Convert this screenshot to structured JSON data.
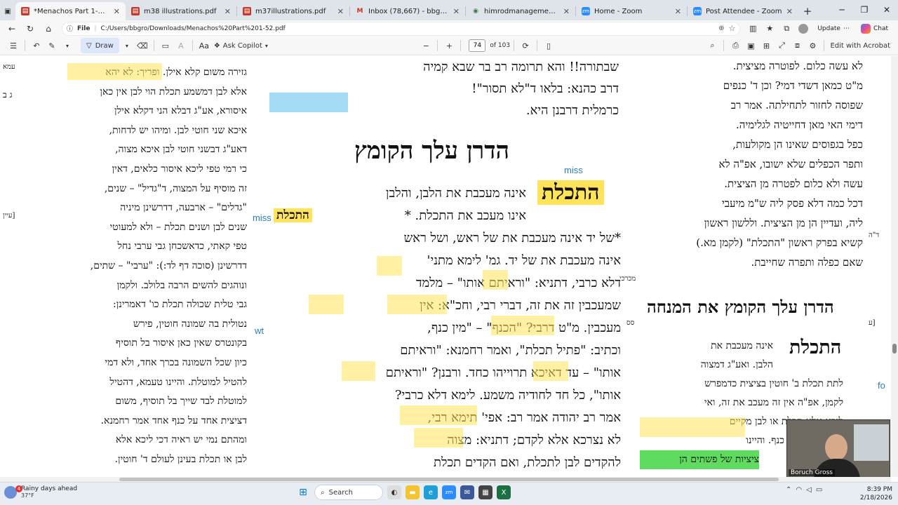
{
  "tabs": [
    {
      "label": "*Menachos Part 1-52.pdf",
      "icon": "pdf-icon",
      "active": true
    },
    {
      "label": "m38 illustrations.pdf",
      "icon": "pdf-icon"
    },
    {
      "label": "m37illustrations.pdf",
      "icon": "pdf-icon"
    },
    {
      "label": "Inbox (78,667) - bbgross10@gm...",
      "icon": "gmail-icon"
    },
    {
      "label": "himrodmanagementllc.manageb...",
      "icon": "web-icon"
    },
    {
      "label": "Home - Zoom",
      "icon": "zoom-icon"
    },
    {
      "label": "Post Attendee - Zoom",
      "icon": "zoom-icon"
    }
  ],
  "address": {
    "label": "File",
    "url": "C:/Users/bbgro/Downloads/Menachos%20Part%201-52.pdf"
  },
  "browser": {
    "update_label": "Update",
    "chat_label": "Chat"
  },
  "pdf_toolbar": {
    "draw_label": "Draw",
    "ask_label": "Ask Copilot",
    "page_current": "74",
    "page_total": "of 103",
    "edit_label": "Edit with Acrobat"
  },
  "document": {
    "left_col": [
      "גזירה משום קלא אילן. ופריך: לא יהא",
      "אלא לבן דמשמע תכלת הוי לבן אין כאן",
      "איסורא, אע\"ג דבלא הני דקלא אילן",
      "איכא שני חוטי לבן. ומיהו יש לדחות,",
      "דאע\"ג דבשני חוטי לבן איכא מצוה,",
      "כי רמי טפי ליכא איסור כלאים, דאין",
      "זה מוסיף על המצוה, ד\"גדיל\" – שנים,",
      "\"גדלים\" – ארבעה, דדרשינן מיניה",
      "שנים לבן ושנים תכלת – ולא למעוטי",
      "טפי קאתי, כדאשכחן גבי ערבי נחל",
      "דדרשינן (סוכה דף לד:): \"ערבי\" – שתים,",
      "ונוהגים להשים הרבה בלולב. ולקמן",
      "גבי טלית שכולה תכלת כו' דאמרינן:",
      "נטולית בה שמונה חוטין, פירש",
      "בקונטרס שאין כאן איסור בל תוסיף",
      "כיון שכל השמונה בכרך אחד, ולא דמי",
      "להטיל למוטלת. והיינו טעמא, דהטיל",
      "למוטלת לבד שייך בל תוסיף, משום",
      "דציצית אחד על כנף אחד אמר רחמנא.",
      "ומהתם נמי יש ראיה דכי ליכא אלא",
      "לבן או תכלת בעינן לעולם ד' חוטין."
    ],
    "center_top": [
      "שבתורה!! והא תרומה רב בר שבא קמיה",
      "דרב כהנא: בלאו ד\"לא תסור\"!",
      "כרמלית דרבנן היא."
    ],
    "center_title": "הדרן עלך הקומץ",
    "center_body": [
      "אינה מעכבת את הלבן, והלבן",
      "אינו מעכב את התכלת. *",
      "*של יד אינה מעכבת את של ראש, ושל ראש",
      "אינה מעכבת את של יד. גמ' לימא מתני'",
      "דלא כרבי, דתניא: \"וראיתם אותו\" – מלמד",
      "שמעכבין זה את זה, דברי רבי, וחכ\"א: אין",
      "מעכבין. מ\"ט דרבי? \"הכנף\" – \"מין כנף,",
      "וכתיב: \"פתיל תכלת\", ואמר רחמנא: \"וראיתם",
      "אותו\" – עד דאיכא תרוייהו כחד. ורבנן? \"וראיתם",
      "אותו\", כל חד לחודיה משמע. לימא דלא כרבי?",
      "אמר רב יהודה אמר רב: אפי' תימא רבי,",
      "לא נצרכא אלא לקדם; דתניא: מצוה",
      "להקדים לבן לתכלת, ואם הקדים תכלת"
    ],
    "center_hl_word": "התכלת",
    "center_hl_small": "התכלת",
    "right_col": [
      "לא עשה כלום. לפוטרה מציצית.",
      "מ\"ט כמאן דשדי דמי? וכן ד' כנפים",
      "שפוסה לחזור לתחילתה. אמר רב",
      "דימי האי מאן דחייטיה לגלימיה.",
      "כפל בגפוסים שאינו הן מקולעות,",
      "ותפר הכפלים שלא ישובו, אפ\"ה לא",
      "עשה ולא כלום לפטרה מן הציצית.",
      "דכל כמה דלא פסק ליה ש\"מ מיעבי",
      "ליה, ועדיין הן מן הציצית. וללשון ראשון",
      "קשיא בפרק ראשון \"התכלת\" (לקמן מא.)",
      "שאם כפלה ותפרה שחייבת."
    ],
    "right_heading": "הדרן עלך הקומץ את המנחה",
    "right_hl_word": "התכלת",
    "right_lower": [
      "אינה מעכבת את",
      "הלבן. ואע\"ג דמצוה",
      "לתת תכלת ב' חוטין בציצית כדמפרש",
      "לקמן, אפ\"ה אין זה מעכב את זה, ואי",
      "ליכא אלא תכלת או לבן מקיים",
      "מצוה, כמו: מין כנף. והיינו",
      "ציציות של פשתים הן"
    ],
    "margins": [
      "עמא",
      "ג ב",
      "[עיין",
      "ד\"ה",
      "מכרכי",
      "סס",
      "[ע"
    ],
    "annotations": [
      "miss",
      "miss",
      "wt",
      "fo"
    ]
  },
  "video": {
    "participant": "Boruch Gross"
  },
  "taskbar": {
    "weather_title": "Rainy days ahead",
    "weather_temp": "37°F",
    "weather_badge": "4",
    "search_label": "Search",
    "time": "8:39 PM",
    "date": "2/18/2026"
  },
  "colors": {
    "highlight_yellow": "#ffe45a",
    "highlight_blue": "#7ccaef",
    "highlight_green": "#5fdc5f",
    "annotation_blue": "#2c7bbf"
  }
}
